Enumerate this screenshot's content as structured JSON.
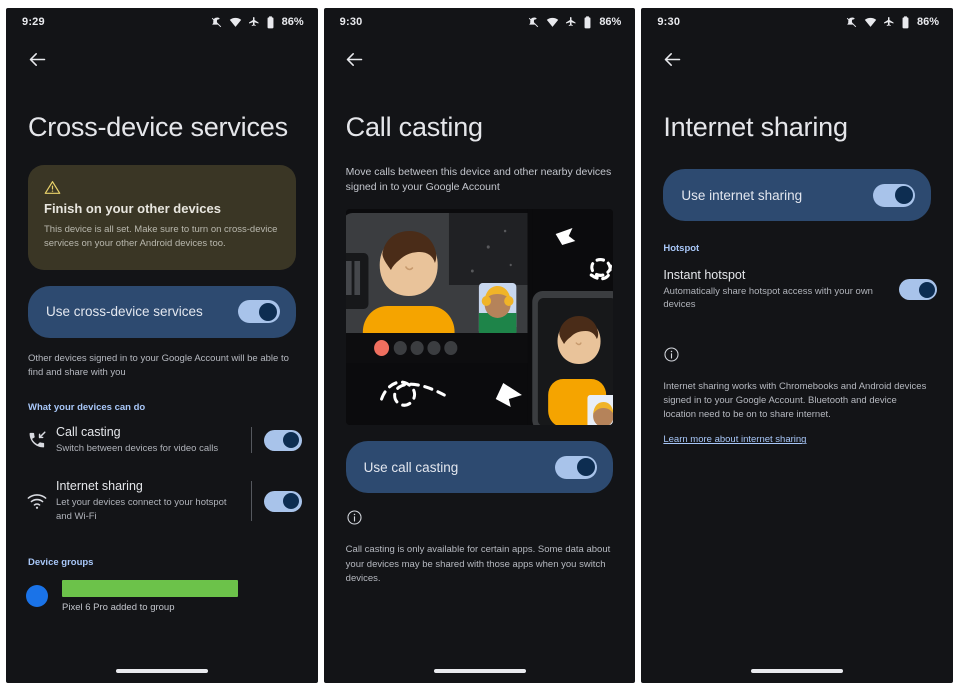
{
  "statusbar": {
    "time_left": "9:29",
    "time_mid": "9:30",
    "time_right": "9:30",
    "battery": "86%",
    "icons": [
      "ringer-mute-icon",
      "wifi-icon",
      "airplane-mode-icon",
      "battery-icon"
    ]
  },
  "colors": {
    "screen_bg": "#131417",
    "accent_blue": "#a8c7f8",
    "card_blue": "#2d4a70",
    "warn_card": "#3a3625",
    "switch_track": "#a8c3ea",
    "switch_thumb": "#0d2d51",
    "redact_green": "#6cc24a",
    "avatar_blue": "#1a73e8"
  },
  "panel1": {
    "title": "Cross-device services",
    "warning": {
      "icon": "warning-triangle-icon",
      "title": "Finish on your other devices",
      "text": "This device is all set. Make sure to turn on cross-device services on your other Android devices too."
    },
    "main_toggle": {
      "label": "Use cross-device services",
      "state": "on"
    },
    "caption": "Other devices signed in to your Google Account will be able to find and share with you",
    "section_header": "What your devices can do",
    "rows": [
      {
        "icon": "call-casting-icon",
        "title": "Call casting",
        "subtitle": "Switch between devices for video calls",
        "state": "on"
      },
      {
        "icon": "wifi-icon",
        "title": "Internet sharing",
        "subtitle": "Let your devices connect to your hotspot and Wi-Fi",
        "state": "on"
      }
    ],
    "groups_header": "Device groups",
    "group": {
      "avatar": "account-avatar",
      "redacted_name": "",
      "subtitle": "Pixel 6 Pro added to group"
    }
  },
  "panel2": {
    "title": "Call casting",
    "subtitle": "Move calls between this device and other nearby devices signed in to your Google Account",
    "illustration": "call-casting-illustration",
    "main_toggle": {
      "label": "Use call casting",
      "state": "on"
    },
    "info_icon": "info-circle-icon",
    "footnote": "Call casting is only available for certain apps. Some data about your devices may be shared with those apps when you switch devices."
  },
  "panel3": {
    "title": "Internet sharing",
    "main_toggle": {
      "label": "Use internet sharing",
      "state": "on"
    },
    "section_header": "Hotspot",
    "rows": [
      {
        "title": "Instant hotspot",
        "subtitle": "Automatically share hotspot access with your own devices",
        "state": "on"
      }
    ],
    "info_icon": "info-circle-icon",
    "footnote": "Internet sharing works with Chromebooks and Android devices signed in to your Google Account. Bluetooth and device location need to be on to share internet.",
    "learn_more": "Learn more about internet sharing"
  }
}
